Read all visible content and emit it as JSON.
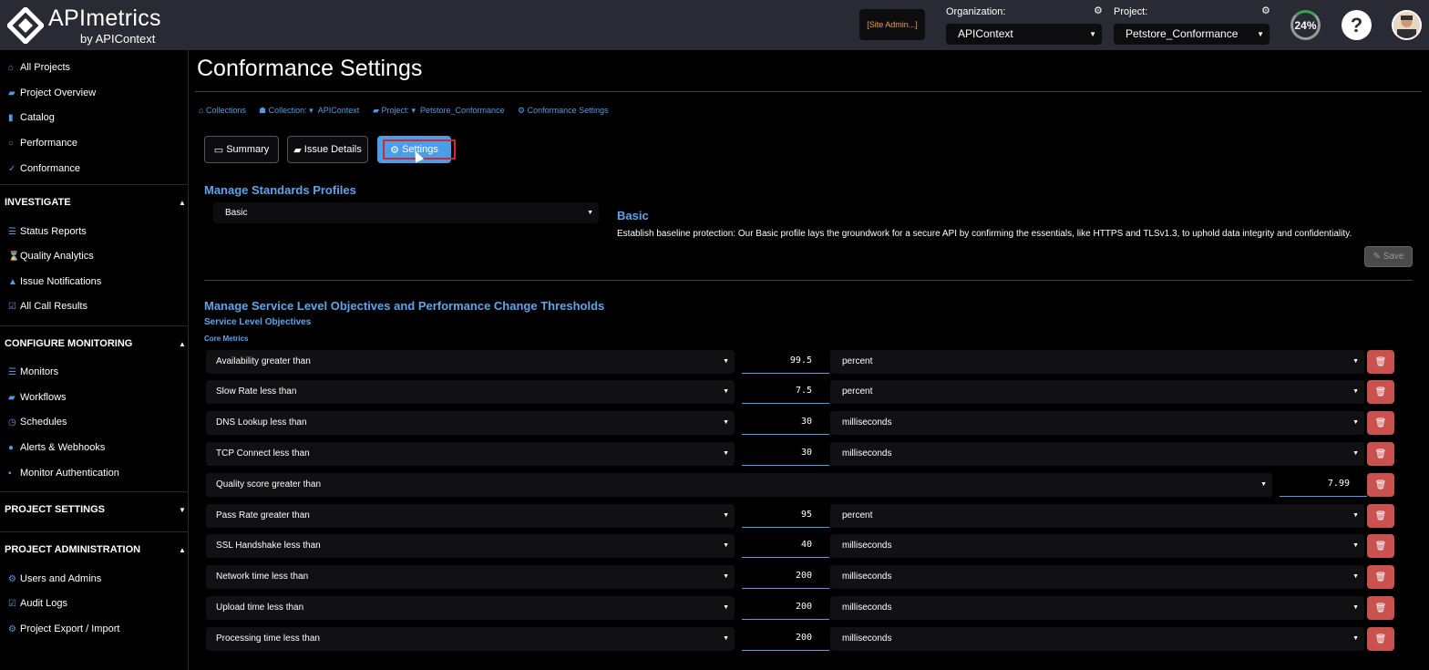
{
  "brand": {
    "name": "APImetrics",
    "sub": "by APIContext"
  },
  "header": {
    "site_admin": "[Site Admin...]",
    "org_label": "Organization:",
    "org_value": "APIContext",
    "project_label": "Project:",
    "project_value": "Petstore_Conformance",
    "progress": "24%",
    "progress_value": 0.24,
    "help": "?"
  },
  "sidebar": {
    "top_items": [
      {
        "icon": "home-icon",
        "label": "All Projects"
      },
      {
        "icon": "folder-open-icon",
        "label": "Project Overview"
      },
      {
        "icon": "book-icon",
        "label": "Catalog"
      },
      {
        "icon": "gauge-icon",
        "label": "Performance"
      },
      {
        "icon": "check-icon",
        "label": "Conformance"
      }
    ],
    "sections": [
      {
        "title": "INVESTIGATE",
        "items": [
          {
            "icon": "list-icon",
            "label": "Status Reports"
          },
          {
            "icon": "hourglass-icon",
            "label": "Quality Analytics"
          },
          {
            "icon": "bell-icon",
            "label": "Issue Notifications"
          },
          {
            "icon": "check-square-icon",
            "label": "All Call Results"
          }
        ]
      },
      {
        "title": "CONFIGURE MONITORING",
        "items": [
          {
            "icon": "list-icon",
            "label": "Monitors"
          },
          {
            "icon": "workflow-icon",
            "label": "Workflows"
          },
          {
            "icon": "clock-icon",
            "label": "Schedules"
          },
          {
            "icon": "globe-icon",
            "label": "Alerts & Webhooks"
          },
          {
            "icon": "lock-icon",
            "label": "Monitor Authentication"
          }
        ]
      },
      {
        "title": "PROJECT SETTINGS",
        "items": []
      },
      {
        "title": "PROJECT ADMINISTRATION",
        "items": [
          {
            "icon": "gear-icon",
            "label": "Users and Admins"
          },
          {
            "icon": "check-square-icon",
            "label": "Audit Logs"
          },
          {
            "icon": "gear-icon",
            "label": "Project Export / Import"
          }
        ]
      }
    ]
  },
  "page": {
    "title": "Conformance Settings",
    "breadcrumb": [
      "Collections",
      "Collection:",
      "APIContext",
      "Project:",
      "Petstore_Conformance",
      "Conformance Settings"
    ],
    "tabs": [
      "Summary",
      "Issue Details",
      "Settings"
    ],
    "active_tab": "Settings"
  },
  "standards": {
    "heading": "Manage Standards Profiles",
    "selected_profile": "Basic",
    "profile_title": "Basic",
    "profile_desc": "Establish baseline protection: Our Basic profile lays the groundwork for a secure API by confirming the essentials, like HTTPS and TLSv1.3, to uphold data integrity and confidentiality.",
    "save_label": "Save"
  },
  "slo": {
    "heading": "Manage Service Level Objectives and Performance Change Thresholds",
    "subheading": "Service Level Objectives",
    "group": "Core Metrics",
    "rows": [
      {
        "metric": "Availability greater than",
        "value": "99.5",
        "unit": "percent"
      },
      {
        "metric": "Slow Rate less than",
        "value": "7.5",
        "unit": "percent"
      },
      {
        "metric": "DNS Lookup less than",
        "value": "30",
        "unit": "milliseconds"
      },
      {
        "metric": "TCP Connect less than",
        "value": "30",
        "unit": "milliseconds"
      },
      {
        "metric": "Quality score greater than",
        "value": "7.99",
        "unit": ""
      },
      {
        "metric": "Pass Rate greater than",
        "value": "95",
        "unit": "percent"
      },
      {
        "metric": "SSL Handshake less than",
        "value": "40",
        "unit": "milliseconds"
      },
      {
        "metric": "Network time less than",
        "value": "200",
        "unit": "milliseconds"
      },
      {
        "metric": "Upload time less than",
        "value": "200",
        "unit": "milliseconds"
      },
      {
        "metric": "Processing time less than",
        "value": "200",
        "unit": "milliseconds"
      }
    ]
  },
  "colors": {
    "accent": "#4a9ee8",
    "danger": "#c9524f",
    "topbar": "#2a2a35",
    "warning_text": "#e8a33c"
  }
}
